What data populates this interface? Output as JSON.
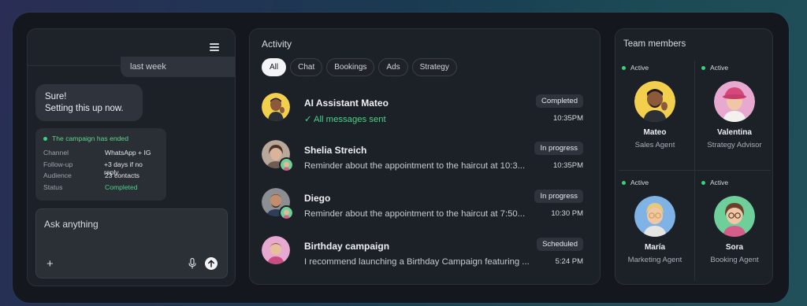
{
  "chat": {
    "previous_message": "last week",
    "reply": "Sure!\nSetting this up now.",
    "reply_line1": "Sure!",
    "reply_line2": "Setting this up now.",
    "campaign": {
      "header": "The campaign has ended",
      "rows": [
        {
          "key": "Channel",
          "value": "WhatsApp + IG"
        },
        {
          "key": "Follow-up",
          "value": "+3 days if no reply"
        },
        {
          "key": "Audience",
          "value": "23 contacts"
        },
        {
          "key": "Status",
          "value": "Completed"
        }
      ]
    },
    "input": {
      "placeholder": "Ask anything",
      "value": ""
    }
  },
  "activity": {
    "title": "Activity",
    "tabs": [
      "All",
      "Chat",
      "Bookings",
      "Ads",
      "Strategy"
    ],
    "active_tab": "All",
    "rows": [
      {
        "name": "AI Assistant Mateo",
        "subtitle": "All messages sent",
        "status": "Completed",
        "time": "10:35PM"
      },
      {
        "name": "Shelia Streich",
        "subtitle": "Reminder about the appointment to the haircut at 10:3...",
        "status": "In progress",
        "time": "10:35PM"
      },
      {
        "name": "Diego",
        "subtitle": "Reminder about the appointment to the haircut at 7:50...",
        "status": "In progress",
        "time": "10:30 PM"
      },
      {
        "name": "Birthday campaign",
        "subtitle": "I recommend launching a Birthday Campaign featuring ...",
        "status": "Scheduled",
        "time": "5:24 PM"
      }
    ]
  },
  "team": {
    "title": "Team members",
    "members": [
      {
        "status": "Active",
        "name": "Mateo",
        "role": "Sales Agent"
      },
      {
        "status": "Active",
        "name": "Valentina",
        "role": "Strategy Advisor"
      },
      {
        "status": "Active",
        "name": "María",
        "role": "Marketing Agent"
      },
      {
        "status": "Active",
        "name": "Sora",
        "role": "Booking Agent"
      }
    ]
  },
  "colors": {
    "accent_green": "#39d27a",
    "panel_bg": "#1c2027",
    "frame_bg": "#14171d"
  },
  "icons": [
    "menu-icon",
    "plus-icon",
    "microphone-icon",
    "send-arrow-icon",
    "check-icon"
  ]
}
